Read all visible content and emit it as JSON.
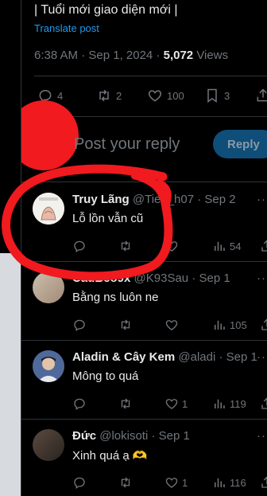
{
  "post": {
    "text": "| Tuổi mới giao diện mới |",
    "translate": "Translate post",
    "time": "6:38 AM · Sep 1, 2024 · ",
    "views_count": "5,072",
    "views_label": " Views"
  },
  "post_stats": {
    "replies": "4",
    "reposts": "2",
    "likes": "100",
    "bookmarks": "3"
  },
  "composer": {
    "placeholder": "Post your reply",
    "button": "Reply",
    "avatar_color": "#f01a1f"
  },
  "replies": [
    {
      "name": "Truy Lãng",
      "handle": "@Tieu_h07",
      "date": "· Sep 2",
      "text": "Lỗ lồn vẫn cũ",
      "replies": "",
      "reposts": "",
      "likes": "",
      "views": "54"
    },
    {
      "name": "CâuBéo9x",
      "handle": "@K93Sau",
      "date": "· Sep 1",
      "text": "Bằng ns luôn ne",
      "replies": "",
      "reposts": "",
      "likes": "",
      "views": "105"
    },
    {
      "name": "Aladin & Cây Kem",
      "handle": "@aladi",
      "date": "· Sep 1",
      "text": "Mông to quá",
      "replies": "",
      "reposts": "",
      "likes": "1",
      "views": "119"
    },
    {
      "name": "Đức",
      "handle": "@lokisoti",
      "date": "· Sep 1",
      "text": "Xinh quá ạ 🫶",
      "replies": "",
      "reposts": "",
      "likes": "1",
      "views": "116"
    }
  ],
  "colors": {
    "accent": "#1d9bf0",
    "annotation_red": "#f01a1f",
    "background": "#000000"
  }
}
